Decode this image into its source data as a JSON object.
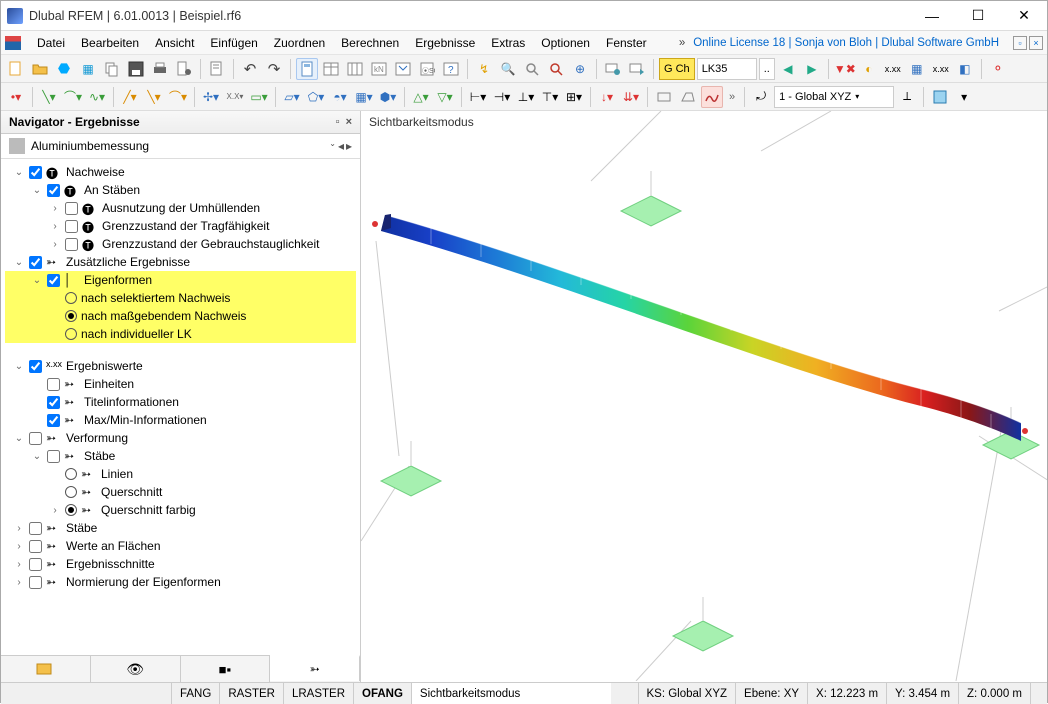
{
  "title": "Dlubal RFEM | 6.01.0013 | Beispiel.rf6",
  "menu": [
    "Datei",
    "Bearbeiten",
    "Ansicht",
    "Einfügen",
    "Zuordnen",
    "Berechnen",
    "Ergebnisse",
    "Extras",
    "Optionen",
    "Fenster"
  ],
  "menu_right": {
    "chev": "»",
    "license": "Online License 18 | Sonja von Bloh | Dlubal Software GmbH"
  },
  "toolbar1": {
    "loadcase_label": "G Ch",
    "loadcase_value": "LK35",
    "loadcase_index": ".."
  },
  "toolbar2": {
    "coordsys": "1 - Global XYZ"
  },
  "sidebar": {
    "title": "Navigator - Ergebnisse",
    "category": "Aluminiumbemessung",
    "nachweise": "Nachweise",
    "an_staben": "An Stäben",
    "ausnutzung": "Ausnutzung der Umhüllenden",
    "gzt": "Grenzzustand der Tragfähigkeit",
    "gzg": "Grenzzustand der Gebrauchstauglichkeit",
    "zus_erg": "Zusätzliche Ergebnisse",
    "eigenformen": "Eigenformen",
    "ef_opt1": "nach selektiertem Nachweis",
    "ef_opt2": "nach maßgebendem Nachweis",
    "ef_opt3": "nach individueller LK",
    "ergebniswerte": "Ergebniswerte",
    "einheiten": "Einheiten",
    "titelinfo": "Titelinformationen",
    "maxmin": "Max/Min-Informationen",
    "verformung": "Verformung",
    "stabe": "Stäbe",
    "linien": "Linien",
    "querschnitt": "Querschnitt",
    "querschnitt_farbig": "Querschnitt farbig",
    "stabe2": "Stäbe",
    "werte_flachen": "Werte an Flächen",
    "ergebnisschnitte": "Ergebnisschnitte",
    "normierung": "Normierung der Eigenformen"
  },
  "viewport_label": "Sichtbarkeitsmodus",
  "status": {
    "fang": "FANG",
    "raster": "RASTER",
    "lraster": "LRASTER",
    "ofang": "OFANG",
    "mode": "Sichtbarkeitsmodus",
    "ks": "KS: Global XYZ",
    "ebene": "Ebene: XY",
    "x": "X: 12.223 m",
    "y": "Y: 3.454 m",
    "z": "Z: 0.000 m"
  }
}
